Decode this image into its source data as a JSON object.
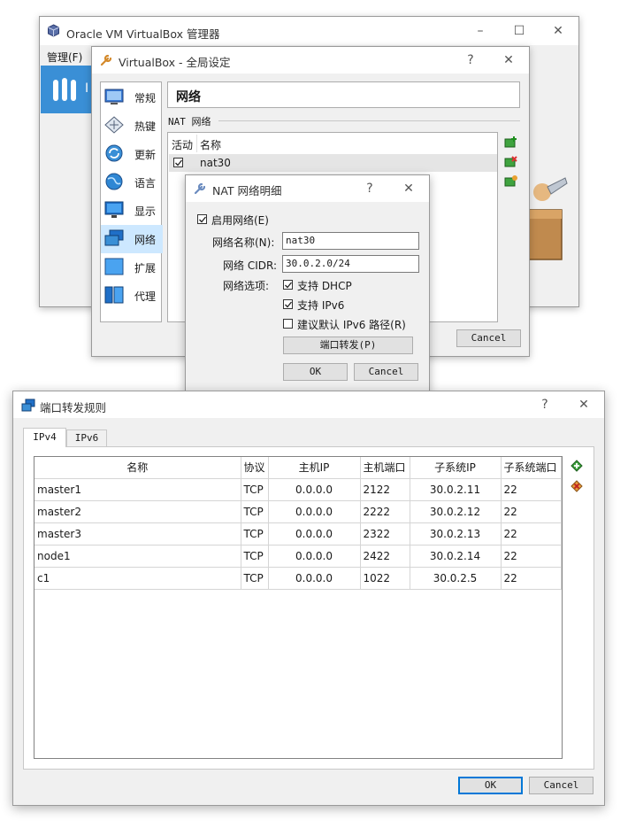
{
  "manager": {
    "title": "Oracle VM VirtualBox 管理器",
    "menu_manage": "管理(F)",
    "tool_label": "I"
  },
  "global_settings": {
    "title": "VirtualBox - 全局设定",
    "help": "?",
    "section_title": "网络",
    "group_label": "NAT 网络",
    "list_headers": {
      "active": "活动",
      "name": "名称"
    },
    "networks": [
      {
        "active": true,
        "name": "nat30"
      }
    ],
    "cancel_label": "Cancel",
    "sidebar": [
      {
        "label": "常规",
        "icon": "general-icon"
      },
      {
        "label": "热键",
        "icon": "hotkey-icon"
      },
      {
        "label": "更新",
        "icon": "update-icon"
      },
      {
        "label": "语言",
        "icon": "language-icon"
      },
      {
        "label": "显示",
        "icon": "display-icon"
      },
      {
        "label": "网络",
        "icon": "network-icon"
      },
      {
        "label": "扩展",
        "icon": "extension-icon"
      },
      {
        "label": "代理",
        "icon": "proxy-icon"
      }
    ]
  },
  "nat_details": {
    "title": "NAT 网络明细",
    "help": "?",
    "enable_label": "启用网络(E)",
    "name_label": "网络名称(N):",
    "name_value": "nat30",
    "cidr_label": "网络 CIDR:",
    "cidr_value": "30.0.2.0/24",
    "options_label": "网络选项:",
    "dhcp_label": "支持 DHCP",
    "ipv6_label": "支持 IPv6",
    "ipv6_route_label": "建议默认 IPv6 路径(R)",
    "port_forward_label": "端口转发(P)",
    "ok_label": "OK",
    "cancel_label": "Cancel"
  },
  "port_forwarding": {
    "title": "端口转发规则",
    "help": "?",
    "tabs": [
      "IPv4",
      "IPv6"
    ],
    "columns": [
      "名称",
      "协议",
      "主机IP",
      "主机端口",
      "子系统IP",
      "子系统端口"
    ],
    "rows": [
      [
        "master1",
        "TCP",
        "0.0.0.0",
        "2122",
        "30.0.2.11",
        "22"
      ],
      [
        "master2",
        "TCP",
        "0.0.0.0",
        "2222",
        "30.0.2.12",
        "22"
      ],
      [
        "master3",
        "TCP",
        "0.0.0.0",
        "2322",
        "30.0.2.13",
        "22"
      ],
      [
        "node1",
        "TCP",
        "0.0.0.0",
        "2422",
        "30.0.2.14",
        "22"
      ],
      [
        "c1",
        "TCP",
        "0.0.0.0",
        "1022",
        "30.0.2.5",
        "22"
      ]
    ],
    "ok_label": "OK",
    "cancel_label": "Cancel"
  },
  "colors": {
    "accent": "#0078d7",
    "selected_row": "#e5e5e5",
    "window_bg": "#f0f0f0"
  }
}
